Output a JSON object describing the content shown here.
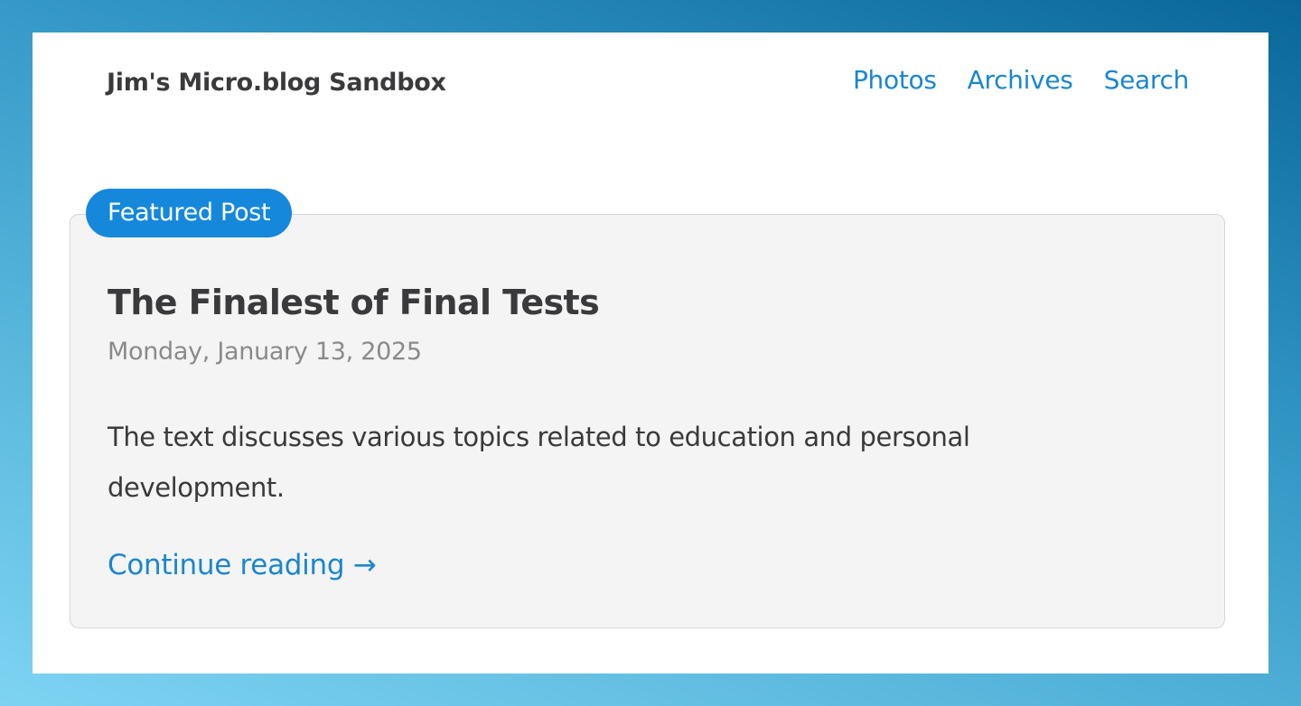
{
  "site": {
    "title": "Jim's Micro.blog Sandbox"
  },
  "nav": {
    "items": [
      {
        "label": "Photos"
      },
      {
        "label": "Archives"
      },
      {
        "label": "Search"
      }
    ]
  },
  "featured": {
    "badge": "Featured Post",
    "title": "The Finalest of Final Tests",
    "date": "Monday, January 13, 2025",
    "summary": "The text discusses various topics related to education and personal development.",
    "continue_label": "Continue reading →"
  },
  "colors": {
    "accent": "#1588db",
    "link": "#1a86d0",
    "text": "#3a3a3c",
    "muted": "#8a8a8c",
    "card_background": "#f4f4f4"
  }
}
